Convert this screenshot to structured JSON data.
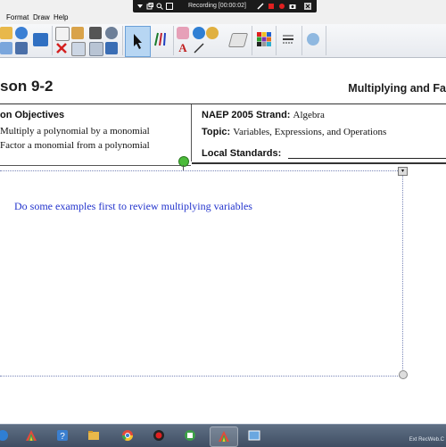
{
  "menubar": {
    "items": [
      "Format",
      "Draw",
      "Help"
    ]
  },
  "recording": {
    "label": "Recording [00:00:02]"
  },
  "lesson": {
    "title": "son 9-2",
    "topic_title": "Multiplying and Fa"
  },
  "objectives": {
    "heading": "on Objectives",
    "items": [
      "Multiply a polynomial by a monomial",
      "Factor a monomial from a polynomial"
    ]
  },
  "standards": {
    "naep_label": "NAEP 2005 Strand:",
    "naep_value": "Algebra",
    "topic_label": "Topic:",
    "topic_value": "Variables, Expressions, and Operations",
    "local_label": "Local Standards:"
  },
  "note": {
    "text": "Do some examples first to review multiplying variables"
  },
  "taskbar": {
    "watermark": "Ext RecWeb.C"
  },
  "colors": {
    "note_text": "#2233cc",
    "rotate_handle": "#4cbb3a",
    "taskbar": "#4a5a70"
  },
  "icons": {
    "recording_bar": [
      "dropdown-icon",
      "restore-icon",
      "zoom-icon",
      "fullscreen-icon",
      "pen-icon",
      "stop-record-icon",
      "record-icon",
      "camera-icon",
      "close-icon"
    ],
    "toolbar": [
      "open-icon",
      "undo-icon",
      "redo-icon",
      "screen-icon",
      "page-icon",
      "delete-icon",
      "table-icon",
      "settings-icon",
      "select-arrow-icon",
      "pens-icon",
      "eraser-icon",
      "fill-icon",
      "text-icon",
      "line-icon",
      "shapes-icon",
      "color-palette-icon",
      "line-style-icon",
      "properties-icon"
    ],
    "taskbar": [
      "start-icon",
      "smart-notebook-icon",
      "help-icon",
      "folder-icon",
      "chrome-icon",
      "media-icon",
      "record-app-icon",
      "notebook-app-icon",
      "desktop-icon"
    ]
  }
}
